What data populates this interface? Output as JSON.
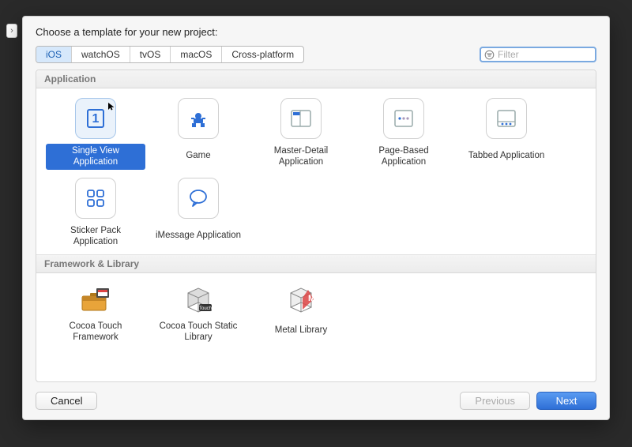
{
  "dialog": {
    "prompt": "Choose a template for your new project:"
  },
  "platforms": {
    "tabs": [
      "iOS",
      "watchOS",
      "tvOS",
      "macOS",
      "Cross-platform"
    ],
    "selected": 0
  },
  "filter": {
    "placeholder": "Filter",
    "value": ""
  },
  "sections": [
    {
      "title": "Application",
      "items": [
        {
          "name": "Single View Application",
          "icon": "single-view-icon",
          "selected": true
        },
        {
          "name": "Game",
          "icon": "game-icon",
          "selected": false
        },
        {
          "name": "Master-Detail Application",
          "icon": "master-detail-icon",
          "selected": false
        },
        {
          "name": "Page-Based Application",
          "icon": "page-based-icon",
          "selected": false
        },
        {
          "name": "Tabbed Application",
          "icon": "tabbed-icon",
          "selected": false
        },
        {
          "name": "Sticker Pack Application",
          "icon": "sticker-pack-icon",
          "selected": false
        },
        {
          "name": "iMessage Application",
          "icon": "imessage-icon",
          "selected": false
        }
      ]
    },
    {
      "title": "Framework & Library",
      "items": [
        {
          "name": "Cocoa Touch Framework",
          "icon": "toolbox-icon",
          "selected": false
        },
        {
          "name": "Cocoa Touch Static Library",
          "icon": "library-icon",
          "selected": false
        },
        {
          "name": "Metal Library",
          "icon": "metal-icon",
          "selected": false
        }
      ]
    }
  ],
  "footer": {
    "cancel": "Cancel",
    "previous": "Previous",
    "next": "Next"
  }
}
